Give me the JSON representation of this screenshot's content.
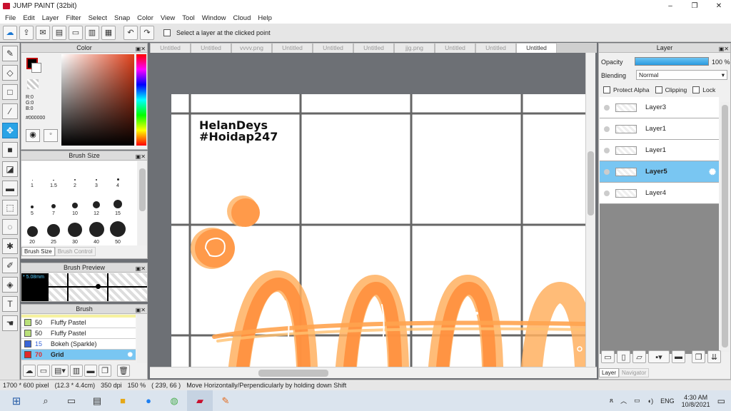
{
  "window": {
    "title": "JUMP PAINT (32bit)",
    "controls": [
      "–",
      "❐",
      "✕"
    ]
  },
  "menu": [
    "File",
    "Edit",
    "Layer",
    "Filter",
    "Select",
    "Snap",
    "Color",
    "View",
    "Tool",
    "Window",
    "Cloud",
    "Help"
  ],
  "toolbar": {
    "select_layer_label": "Select a layer at the clicked point"
  },
  "tabs": [
    "Untitled",
    "Untitled",
    "vvvv.png",
    "Untitled",
    "Untitled",
    "Untitled",
    "jjg.png",
    "Untitled",
    "Untitled",
    "Untitled"
  ],
  "color_panel": {
    "title": "Color",
    "r": "R:0",
    "g": "G:0",
    "b": "B:0",
    "hex": "#000000",
    "primary": "#000000",
    "secondary": "#ffffff"
  },
  "brush_size_panel": {
    "title": "Brush Size",
    "sizes": [
      "1",
      "1.5",
      "2",
      "3",
      "4",
      "5",
      "7",
      "10",
      "12",
      "15",
      "20",
      "25",
      "30",
      "40",
      "50"
    ],
    "tab_active": "Brush Size",
    "tab_inactive": "Brush Control"
  },
  "brush_preview": {
    "title": "Brush Preview",
    "size": "* 5.08mm"
  },
  "brush_panel": {
    "title": "Brush",
    "items": [
      {
        "size": "50",
        "name": "Fluffy Pastel",
        "color": "#b9e07a"
      },
      {
        "size": "50",
        "name": "Fluffy Pastel",
        "color": "#b9e07a"
      },
      {
        "size": "15",
        "name": "Bokeh (Sparkle)",
        "color": "#3a66d8"
      },
      {
        "size": "70",
        "name": "Grid",
        "color": "#e02a2a"
      }
    ]
  },
  "canvas": {
    "text_line1": "HelanDeys",
    "text_line2": "#Hoidap247"
  },
  "layer_panel": {
    "title": "Layer",
    "opacity_label": "Opacity",
    "opacity_value": "100 %",
    "opacity": 1.0,
    "blending_label": "Blending",
    "blending_value": "Normal",
    "protect_alpha": "Protect Alpha",
    "clipping": "Clipping",
    "lock": "Lock",
    "layers": [
      {
        "name": "Layer3",
        "selected": false
      },
      {
        "name": "Layer1",
        "selected": false
      },
      {
        "name": "Layer1",
        "selected": false
      },
      {
        "name": "Layer5",
        "selected": true
      },
      {
        "name": "Layer4",
        "selected": false
      }
    ],
    "tab_active": "Layer",
    "tab_inactive": "Navigator"
  },
  "status": {
    "canvas_size": "1700 * 600 pixel",
    "physical": "(12.3 * 4.4cm)",
    "dpi": "350 dpi",
    "zoom": "150 %",
    "coords": "( 239, 66 )",
    "hint": "Move Horizontally/Perpendicularly by holding down Shift"
  },
  "taskbar": {
    "lang": "ENG",
    "time": "4:30 AM",
    "date": "10/8/2021"
  },
  "colors": {
    "accent": "#29a3e6",
    "selected_row": "#79c6f2",
    "orange": "#ff9a4a"
  }
}
